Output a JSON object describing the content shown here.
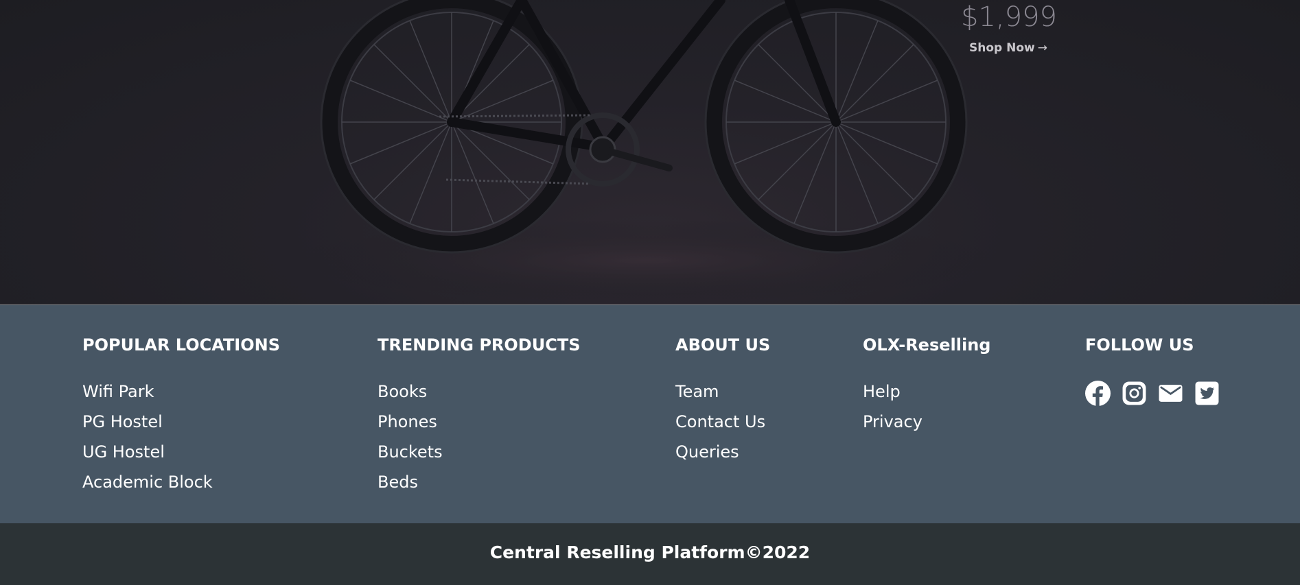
{
  "hero": {
    "price": "$1,999",
    "shop_now": "Shop Now",
    "shop_arrow": "→"
  },
  "footer": {
    "columns": [
      {
        "heading": "POPULAR LOCATIONS",
        "items": [
          "Wifi Park",
          "PG Hostel",
          "UG Hostel",
          "Academic Block"
        ]
      },
      {
        "heading": "TRENDING PRODUCTS",
        "items": [
          "Books",
          "Phones",
          "Buckets",
          "Beds"
        ]
      },
      {
        "heading": "ABOUT US",
        "items": [
          "Team",
          "Contact Us",
          "Queries"
        ]
      },
      {
        "heading": "OLX-Reselling",
        "items": [
          "Help",
          "Privacy"
        ]
      },
      {
        "heading": "FOLLOW US",
        "social": [
          "facebook-icon",
          "instagram-icon",
          "mail-icon",
          "twitter-icon"
        ]
      }
    ]
  },
  "copyright": "Central Reselling Platform©2022",
  "colors": {
    "footer_bg": "#475664",
    "bottom_bar_bg": "#2c3336",
    "hero_bg": "#1d1d22",
    "text": "#ffffff"
  }
}
